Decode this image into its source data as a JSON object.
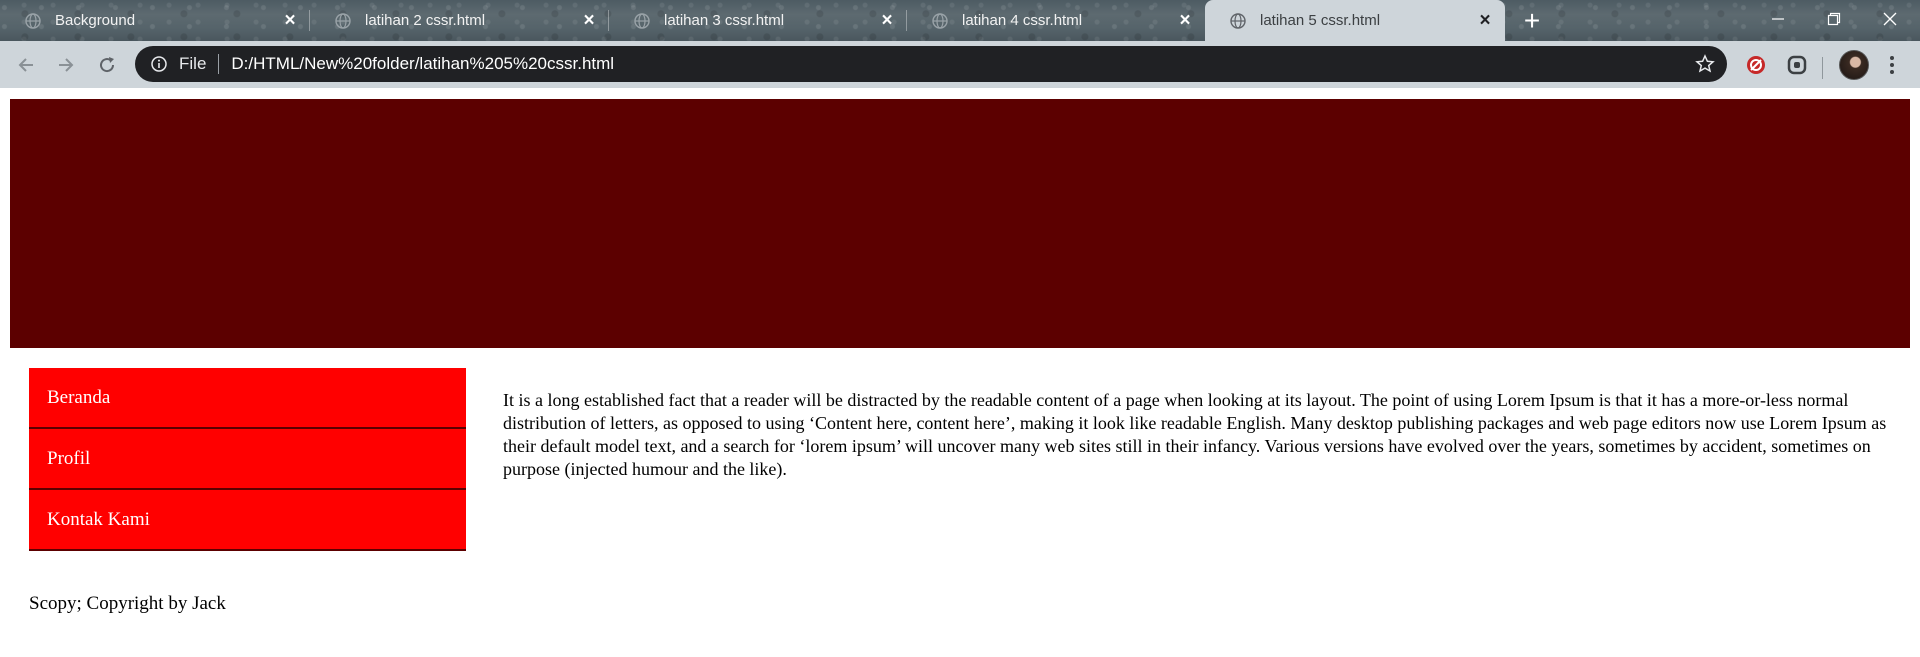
{
  "browser": {
    "tabs": [
      {
        "title": "Background",
        "active": false
      },
      {
        "title": "latihan 2 cssr.html",
        "active": false
      },
      {
        "title": "latihan 3 cssr.html",
        "active": false
      },
      {
        "title": "latihan 4 cssr.html",
        "active": false
      },
      {
        "title": "latihan 5 cssr.html",
        "active": true
      }
    ],
    "new_tab_label": "+",
    "address_bar": {
      "scheme_label": "File",
      "url": "D:/HTML/New%20folder/latihan%205%20cssr.html"
    },
    "icons": {
      "tab_favicon": "globe-icon",
      "back": "back-arrow-icon",
      "forward": "forward-arrow-icon",
      "reload": "reload-icon",
      "info": "info-icon",
      "bookmark": "star-icon",
      "menu": "more-vert-icon"
    }
  },
  "page": {
    "colors": {
      "banner": "#5c0000",
      "menu_background": "#ff0000",
      "menu_border": "#5c0000",
      "menu_text": "#ffffff"
    },
    "menu": [
      {
        "label": "Beranda"
      },
      {
        "label": "Profil"
      },
      {
        "label": "Kontak Kami"
      }
    ],
    "content_text": "It is a long established fact that a reader will be distracted by the readable content of a page when looking at its layout. The point of using Lorem Ipsum is that it has a more-or-less normal distribution of letters, as opposed to using ‘Content here, content here’, making it look like readable English. Many desktop publishing packages and web page editors now use Lorem Ipsum as their default model text, and a search for ‘lorem ipsum’ will uncover many web sites still in their infancy. Various versions have evolved over the years, sometimes by accident, sometimes on purpose (injected humour and the like).",
    "footer_text": "Scopy; Copyright by Jack"
  }
}
